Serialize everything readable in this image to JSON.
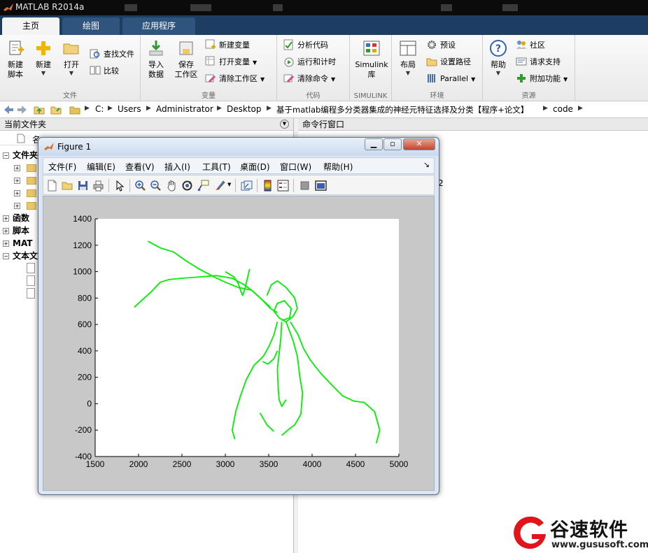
{
  "app": {
    "title": "MATLAB R2014a"
  },
  "tabs": [
    {
      "label": "主页"
    },
    {
      "label": "绘图"
    },
    {
      "label": "应用程序"
    }
  ],
  "ribbon": {
    "file": {
      "label": "文件",
      "new_script": "新建\n脚本",
      "new": "新建",
      "open": "打开",
      "find_files": "查找文件",
      "compare": "比较"
    },
    "variable": {
      "label": "变量",
      "import": "导入\n数据",
      "save_ws": "保存\n工作区",
      "new_var": "新建变量",
      "open_var": "打开变量",
      "clear_ws": "清除工作区"
    },
    "code": {
      "label": "代码",
      "analyze": "分析代码",
      "run_time": "运行和计时",
      "clear_cmd": "清除命令"
    },
    "simulink": {
      "label": "SIMULINK",
      "lib": "Simulink\n库"
    },
    "env": {
      "label": "环境",
      "layout": "布局",
      "prefs": "预设",
      "set_path": "设置路径",
      "parallel": "Parallel"
    },
    "resources": {
      "label": "资源",
      "help": "帮助",
      "community": "社区",
      "support": "请求支持",
      "addons": "附加功能"
    }
  },
  "address": {
    "crumbs": [
      "C:",
      "Users",
      "Administrator",
      "Desktop",
      "基于matlab编程多分类器集成的神经元特征选择及分类【程序+论文】",
      "code"
    ]
  },
  "left_panel": {
    "header": "当前文件夹",
    "column_name": "名",
    "tree": [
      "文件夹",
      "函数",
      "脚本",
      "MAT",
      "文本文"
    ]
  },
  "right_panel": {
    "header": "命令行窗口",
    "partial_char": "2"
  },
  "figure": {
    "title": "Figure 1",
    "menus": [
      "文件(F)",
      "编辑(E)",
      "查看(V)",
      "插入(I)",
      "工具(T)",
      "桌面(D)",
      "窗口(W)",
      "帮助(H)"
    ],
    "toolbar_icons": [
      "new-figure-icon",
      "open-icon",
      "save-icon",
      "print-icon",
      "pointer-icon",
      "zoom-in-icon",
      "zoom-out-icon",
      "pan-icon",
      "rotate-icon",
      "data-cursor-icon",
      "brush-icon",
      "link-icon",
      "colorbar-icon",
      "legend-icon",
      "hide-plot-tools-icon",
      "show-plot-tools-icon"
    ]
  },
  "chart_data": {
    "type": "line",
    "line_color": "#00ee00",
    "title": "",
    "xlabel": "",
    "ylabel": "",
    "xlim": [
      1500,
      5000
    ],
    "ylim": [
      -400,
      1400
    ],
    "xticks": [
      1500,
      2000,
      2500,
      3000,
      3500,
      4000,
      4500,
      5000
    ],
    "yticks": [
      -400,
      -200,
      0,
      200,
      400,
      600,
      800,
      1000,
      1200,
      1400
    ],
    "grid": false,
    "series": [
      {
        "points": [
          [
            2110,
            1230
          ],
          [
            2250,
            1180
          ],
          [
            2400,
            1150
          ],
          [
            2550,
            1080
          ],
          [
            2700,
            1020
          ],
          [
            2870,
            960
          ],
          [
            3000,
            920
          ],
          [
            3150,
            880
          ],
          [
            3300,
            860
          ],
          [
            3420,
            790
          ],
          [
            3520,
            720
          ],
          [
            3600,
            690
          ]
        ]
      },
      {
        "points": [
          [
            1950,
            730
          ],
          [
            2050,
            790
          ],
          [
            2150,
            850
          ],
          [
            2250,
            920
          ],
          [
            2350,
            940
          ],
          [
            2500,
            950
          ],
          [
            2700,
            960
          ],
          [
            2900,
            970
          ],
          [
            3080,
            950
          ],
          [
            3220,
            900
          ],
          [
            3320,
            850
          ],
          [
            3420,
            790
          ],
          [
            3520,
            730
          ]
        ]
      },
      {
        "points": [
          [
            3000,
            1000
          ],
          [
            3100,
            960
          ],
          [
            3150,
            910
          ],
          [
            3180,
            850
          ],
          [
            3200,
            820
          ],
          [
            3230,
            880
          ],
          [
            3280,
            1020
          ]
        ]
      },
      {
        "points": [
          [
            3480,
            820
          ],
          [
            3530,
            900
          ],
          [
            3600,
            930
          ],
          [
            3700,
            880
          ],
          [
            3800,
            800
          ],
          [
            3830,
            720
          ],
          [
            3780,
            660
          ],
          [
            3700,
            620
          ],
          [
            3620,
            650
          ],
          [
            3560,
            700
          ],
          [
            3600,
            760
          ],
          [
            3680,
            780
          ],
          [
            3760,
            720
          ],
          [
            3740,
            650
          ],
          [
            3650,
            630
          ]
        ]
      },
      {
        "points": [
          [
            3600,
            620
          ],
          [
            3560,
            520
          ],
          [
            3500,
            430
          ],
          [
            3440,
            360
          ],
          [
            3330,
            290
          ],
          [
            3240,
            180
          ],
          [
            3170,
            50
          ],
          [
            3120,
            -60
          ],
          [
            3080,
            -200
          ],
          [
            3110,
            -270
          ]
        ]
      },
      {
        "points": [
          [
            3700,
            620
          ],
          [
            3780,
            480
          ],
          [
            3830,
            360
          ],
          [
            3860,
            200
          ],
          [
            3890,
            80
          ],
          [
            3870,
            -80
          ],
          [
            3800,
            -160
          ],
          [
            3720,
            -200
          ],
          [
            3650,
            -240
          ]
        ]
      },
      {
        "points": [
          [
            3650,
            620
          ],
          [
            3640,
            500
          ],
          [
            3620,
            380
          ],
          [
            3600,
            260
          ],
          [
            3610,
            120
          ],
          [
            3620,
            30
          ],
          [
            3650,
            -20
          ],
          [
            3700,
            30
          ]
        ]
      },
      {
        "points": [
          [
            3750,
            620
          ],
          [
            3840,
            520
          ],
          [
            3900,
            420
          ],
          [
            3980,
            330
          ],
          [
            4100,
            230
          ],
          [
            4230,
            140
          ],
          [
            4350,
            60
          ],
          [
            4480,
            20
          ],
          [
            4600,
            10
          ],
          [
            4720,
            -60
          ],
          [
            4780,
            -200
          ],
          [
            4740,
            -300
          ]
        ]
      },
      {
        "points": [
          [
            3600,
            400
          ],
          [
            3560,
            340
          ],
          [
            3490,
            300
          ],
          [
            3430,
            320
          ]
        ]
      },
      {
        "points": [
          [
            3400,
            -70
          ],
          [
            3480,
            -160
          ],
          [
            3560,
            -210
          ]
        ]
      }
    ]
  }
}
